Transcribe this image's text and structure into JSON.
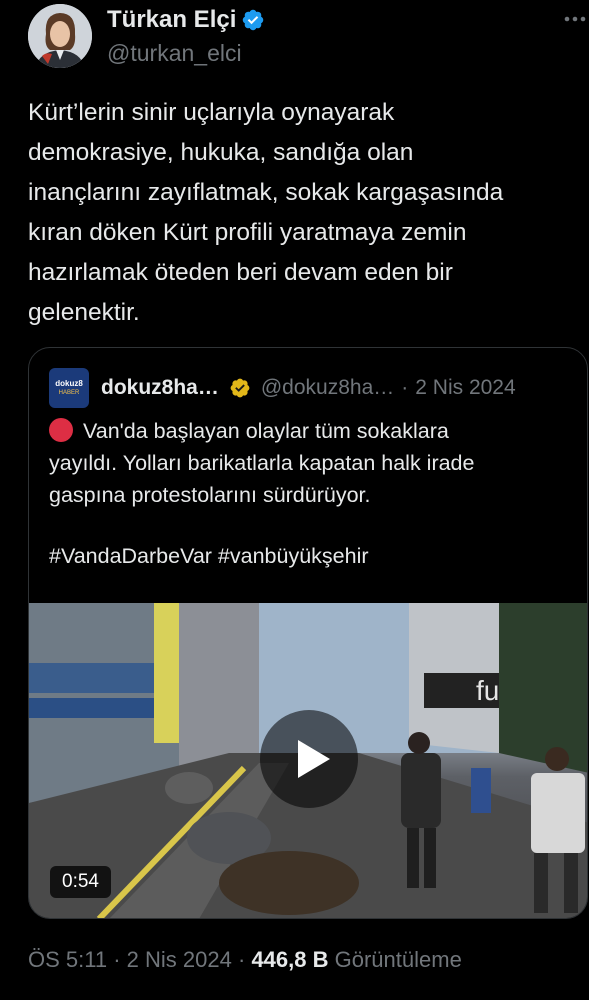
{
  "author": {
    "display_name": "Türkan Elçi",
    "handle": "@turkan_elci",
    "verified_color": "#1d9bf0"
  },
  "tweet": {
    "text": "Kürt’lerin sinir uçlarıyla oynayarak\ndemokrasiye, hukuka, sandığa olan\ninançlarını zayıflatmak, sokak kargaşasında\nkıran döken Kürt profili yaratmaya zemin\nhazırlamak öteden beri devam eden bir\ngelenektir."
  },
  "quote": {
    "avatar_text": "dokuz8",
    "avatar_subtext": "HABER",
    "display_name": "dokuz8ha…",
    "badge_color": "#e2b719",
    "handle": "@dokuz8ha…",
    "separator": "·",
    "date": "2 Nis 2024",
    "text_lines": [
      "Van'da başlayan olaylar tüm sokaklara",
      "yayıldı. Yolları barikatlarla kapatan halk irade",
      "gaspına protestolarını sürdürüyor."
    ],
    "hashtags": "#VandaDarbeVar #vanbüyükşehir",
    "video": {
      "duration": "0:54",
      "sign_text": "fu"
    }
  },
  "meta": {
    "time": "ÖS 5:11",
    "sep1": "·",
    "date": "2 Nis 2024",
    "sep2": "·",
    "views": "446,8 B",
    "views_label": "Görüntüleme"
  }
}
